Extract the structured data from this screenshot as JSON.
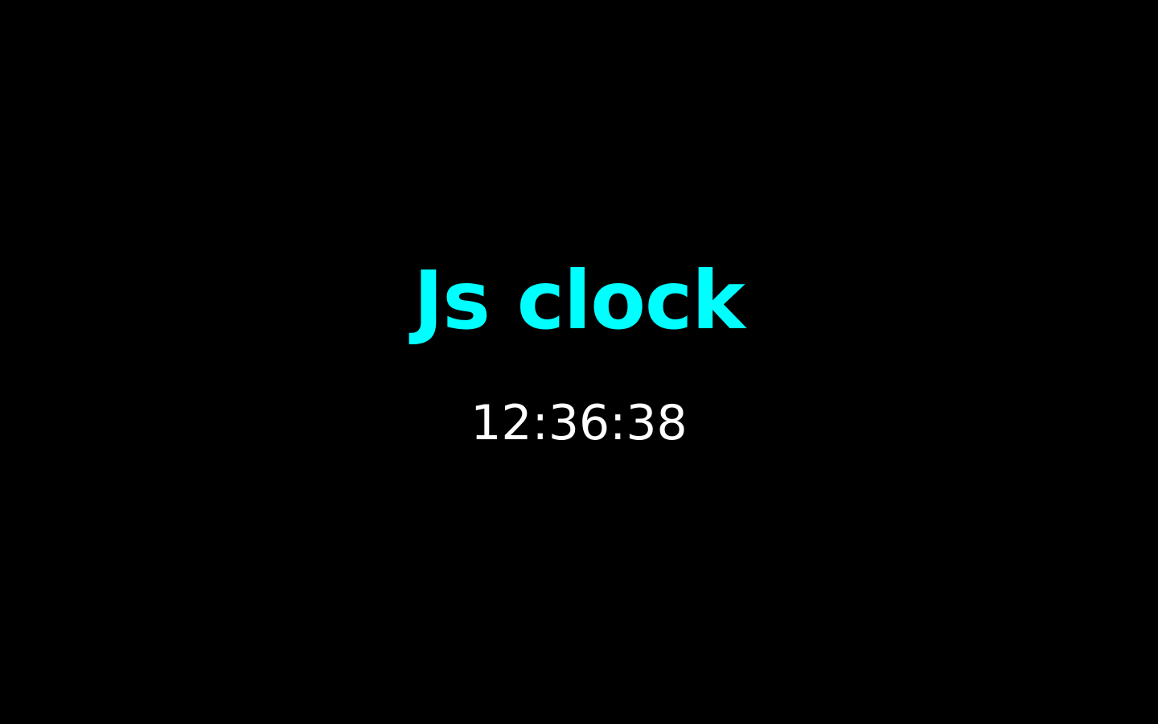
{
  "page": {
    "background_color": "#000000"
  },
  "clock": {
    "title": "Js clock",
    "title_color": "#00ffff",
    "time": "12:36:38",
    "time_color": "#ffffff"
  }
}
